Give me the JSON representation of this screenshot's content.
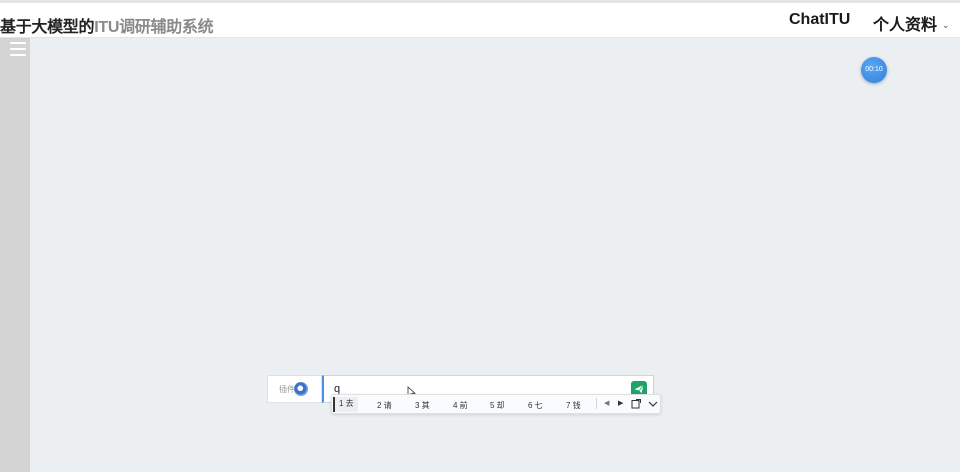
{
  "header": {
    "title_main": "基于大模型的",
    "title_rest": "ITU调研辅助系统",
    "nav_chat": "ChatITU",
    "nav_profile": "个人资料"
  },
  "timer": {
    "label": "00:10"
  },
  "plugin": {
    "label": "插件"
  },
  "chat": {
    "input_value": "q"
  },
  "ime": {
    "candidates": [
      "1 去",
      "2 请",
      "3 其",
      "4 前",
      "5 却",
      "6 七",
      "7 钱"
    ]
  },
  "colors": {
    "send_button": "#21a366",
    "timer": "#3a8bea",
    "sidebar": "#d4d4d4",
    "background": "#ebeff2"
  }
}
